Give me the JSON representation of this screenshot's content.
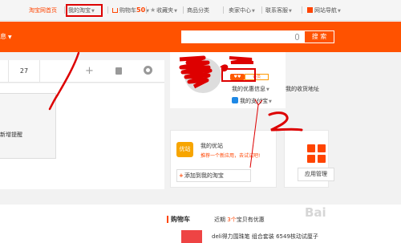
{
  "topnav": {
    "home": "淘宝网首页",
    "my_taobao": "我的淘宝",
    "cart_label": "购物车",
    "cart_count": "50",
    "favorites": "收藏夹",
    "categories": "商品分类",
    "seller_center": "卖家中心",
    "contact": "联系客服",
    "site_nav": "网站导航"
  },
  "header": {
    "left_text": "息",
    "search_button": "搜 索"
  },
  "left_panel": {
    "cell_value": "27",
    "reminder_text": "新增提醒"
  },
  "profile": {
    "vip_label": "会员",
    "my_benefits": "我的优惠信息",
    "shipping_address": "我的收货地址",
    "my_alipay": "我的支付宝"
  },
  "youzhan": {
    "icon_text": "优站",
    "title": "我的优站",
    "desc": "推荐一个新应用，去试试吧!",
    "add_button": "添加到我的淘宝"
  },
  "apps": {
    "button": "应用管理"
  },
  "cart": {
    "title": "购物车",
    "sub_prefix": "近期",
    "sub_num": "3个",
    "sub_suffix": "宝贝有优惠",
    "product_name": "deli得力围珠笔 组合套装 6549核动试厘子"
  },
  "watermark": "Bai",
  "colors": {
    "brand_orange": "#ff5200",
    "annotation_red": "#dd0000"
  }
}
